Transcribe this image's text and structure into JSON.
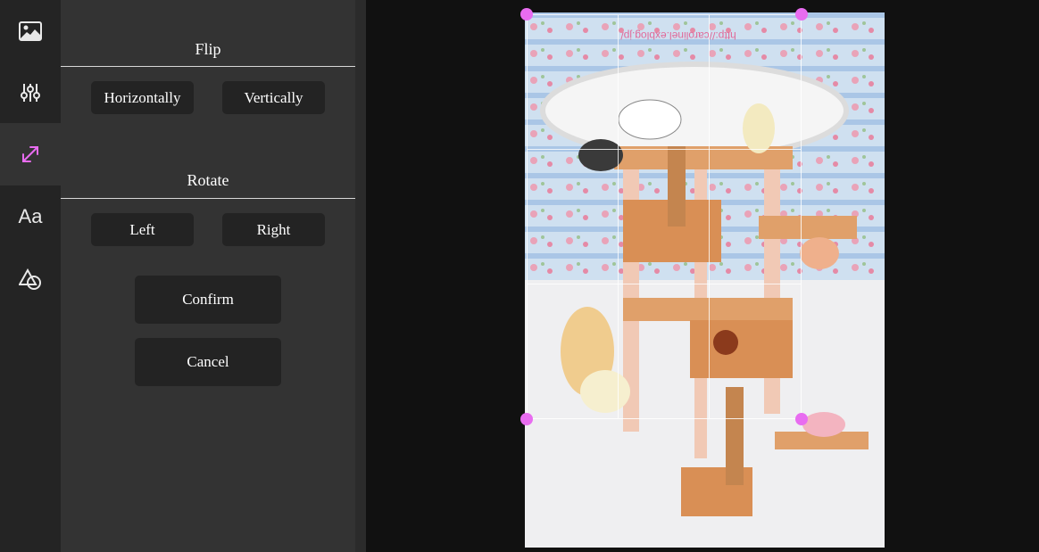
{
  "toolbar": {
    "items": [
      {
        "icon": "image-icon",
        "active": false
      },
      {
        "icon": "sliders-icon",
        "active": false
      },
      {
        "icon": "resize-icon",
        "active": true
      },
      {
        "icon": "text-icon",
        "label": "Aa",
        "active": false
      },
      {
        "icon": "shapes-icon",
        "active": false
      }
    ]
  },
  "panel": {
    "flip": {
      "title": "Flip",
      "horizontal": "Horizontally",
      "vertical": "Vertically"
    },
    "rotate": {
      "title": "Rotate",
      "left": "Left",
      "right": "Right"
    },
    "confirm": "Confirm",
    "cancel": "Cancel"
  },
  "canvas": {
    "watermark": "http://carolinel.exblog.jp/",
    "accent_color": "#e86cf0"
  }
}
